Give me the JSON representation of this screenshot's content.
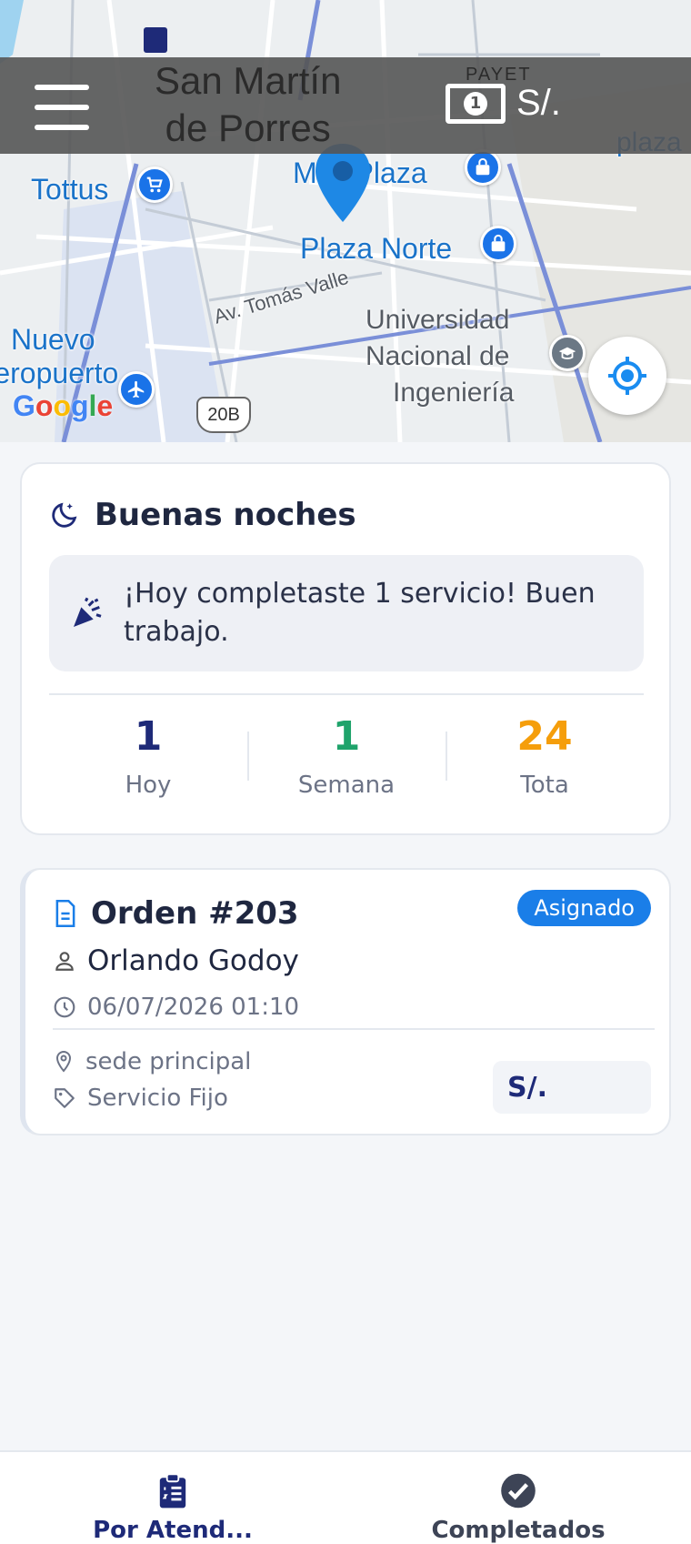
{
  "map": {
    "district": [
      "San Martín",
      "de Porres"
    ],
    "labels": {
      "tottus": "Tottus",
      "mall_plaza": "Mall Plaza",
      "plaza_norte": "Plaza Norte",
      "av_tomas_valle": "Av. Tomás Valle",
      "universidad": [
        "Universidad",
        "Nacional de",
        "Ingeniería"
      ],
      "nuevo_aeropuerto": [
        "Nuevo",
        "Aeropuerto"
      ],
      "plaza_right": "plaza",
      "payet": "PAYET",
      "route_badge": "20B",
      "google_letters": [
        "G",
        "o",
        "o",
        "g",
        "l",
        "e"
      ]
    }
  },
  "topbar": {
    "balance": "S/."
  },
  "summary": {
    "greeting": "Buenas noches",
    "banner": "¡Hoy completaste 1 servicio! Buen trabajo.",
    "stats": [
      {
        "value": "1",
        "label": "Hoy",
        "color": "#1e2a78"
      },
      {
        "value": "1",
        "label": "Semana",
        "color": "#1fa36b"
      },
      {
        "value": "24",
        "label": "Tota",
        "color": "#f59e0b"
      }
    ]
  },
  "order": {
    "title": "Orden #203",
    "status": "Asignado",
    "client": "Orlando Godoy",
    "datetime": "06/07/2026 01:10",
    "location": "sede principal",
    "service": "Servicio Fijo",
    "amount": "S/."
  },
  "nav": {
    "pending": "Por Atend...",
    "completed": "Completados"
  },
  "colors": {
    "primary": "#1e2a78",
    "accent_blue": "#1a7ee8",
    "nav_inactive": "#3d4456"
  }
}
